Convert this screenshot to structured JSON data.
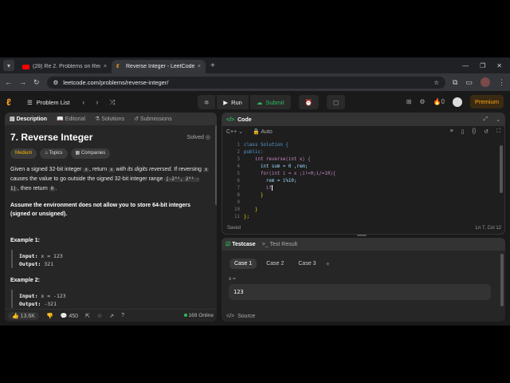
{
  "browser": {
    "tabs": [
      {
        "title": "(28) Re 2. Problems on Recursio",
        "close": "×"
      },
      {
        "title": "Reverse Integer - LeetCode",
        "close": "×"
      }
    ],
    "url": "leetcode.com/problems/reverse-integer/"
  },
  "header": {
    "problem_list": "Problem List",
    "run": "Run",
    "submit": "Submit",
    "streak": "0",
    "premium": "Premium"
  },
  "left": {
    "tabs": [
      "Description",
      "Editorial",
      "Solutions",
      "Submissions"
    ],
    "title": "7. Reverse Integer",
    "status": "Solved",
    "chips": [
      "Medium",
      "Topics",
      "Companies"
    ],
    "desc1": "Given a signed 32-bit integer",
    "x": "x",
    "desc2": ", return",
    "desc3": "with its digits reversed",
    "desc4": ". If reversing",
    "desc5": "causes the value to go outside the signed 32-bit integer range",
    "range_lo": "[-2³¹, 2³¹ - 1]",
    "desc6": ", then return",
    "zero": "0",
    "assume": "Assume the environment does not allow you to store 64-bit integers (signed or unsigned).",
    "example1": {
      "title": "Example 1:",
      "input_label": "Input:",
      "input": "x = 123",
      "output_label": "Output:",
      "output": "321"
    },
    "example2": {
      "title": "Example 2:",
      "input_label": "Input:",
      "input": "x = -123",
      "output_label": "Output:",
      "output": "-321"
    },
    "likes": "13.6K",
    "comments": "450",
    "online": "169 Online"
  },
  "code": {
    "title": "Code",
    "lang": "C++",
    "mode": "Auto",
    "lines": [
      "class Solution {",
      "public:",
      "    int reverse(int x) {",
      "      int sum = 0 ,rem;",
      "      for(int i = x ;i!=0;i/=10){",
      "        rem = i%10;",
      "        if",
      "      }",
      "",
      "    }",
      "};"
    ],
    "status_left": "Saved",
    "status_right": "Ln 7, Col 12"
  },
  "testcase": {
    "tab1": "Testcase",
    "tab2": "Test Result",
    "cases": [
      "Case 1",
      "Case 2",
      "Case 3"
    ],
    "label": "x =",
    "value": "123",
    "footer": "Source"
  }
}
